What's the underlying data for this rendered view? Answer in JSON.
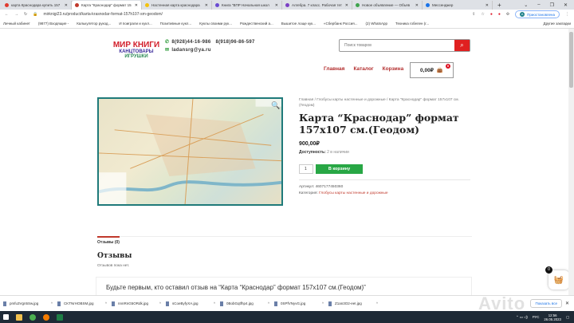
{
  "browser": {
    "tabs": [
      {
        "label": "карта Краснодара купить 157",
        "color": "#e03b2f",
        "active": false
      },
      {
        "label": "Карта \"Краснодар\" формат 15",
        "color": "#c0392b",
        "active": true
      },
      {
        "label": "Настенная карта краснодара",
        "color": "#f4c20d",
        "active": false
      },
      {
        "label": "Книга \"ВПР Начальная школ",
        "color": "#6a4bd1",
        "active": false
      },
      {
        "label": "Алгебра. 7 класс. Рабочая тет",
        "color": "#7b3fc4",
        "active": false
      },
      {
        "label": "Новое объявление — Объяв",
        "color": "#3fa34d",
        "active": false
      },
      {
        "label": "Мессенджер",
        "color": "#1a73e8",
        "active": false
      }
    ],
    "url": "mirknigi23.ru/product/karta-krasnodar-format-157h107-sm-geodom/",
    "profile": "Приостановлена",
    "profile_initial": "А",
    "bookmarks": [
      "Личный кабинет",
      "(9877) Входящие -",
      "Калькулятор рукод...",
      "И поиграли и кукл...",
      "Позитивные кукл...",
      "Куклы своими рук...",
      "Рождественский а...",
      "Вышитое лоще кук...",
      "«Сбербанк Россия...",
      "(2) WhatsApp",
      "Техника гобелен (г..."
    ],
    "other_bookmarks": "Другие закладки"
  },
  "header": {
    "logo": {
      "line1": "МИР КНИГИ",
      "line2": "КАНЦТОВАРЫ",
      "line3": "ИГРУШКИ"
    },
    "phone1": "8(928)44-16-986",
    "phone2": "8(918)96-86-597",
    "email": "ladansrg@ya.ru",
    "search_placeholder": "Поиск товаров",
    "nav": [
      "Главная",
      "Каталог",
      "Корзина"
    ],
    "cart_total": "0,00₽",
    "cart_count": "0"
  },
  "product": {
    "breadcrumb": "Главная / Глобусы карты настенные и дорожные / Карта \"Краснодар\" формат 157х107 см.(Геодом)",
    "title": "Карта “Краснодар” формат 157х107 см.(Геодом)",
    "price": "900,00₽",
    "availability_label": "Доступность:",
    "availability_value": "2 в наличии",
    "qty": "1",
    "add_to_cart": "В корзину",
    "sku_label": "Артикул:",
    "sku": "4607177450360",
    "category_label": "Категория:",
    "category": "Глобусы карты настенные и дорожные"
  },
  "reviews": {
    "tab": "Отзывы (0)",
    "heading": "Отзывы",
    "none": "Отзывов пока нет.",
    "prompt": "Будьте первым, кто оставил отзыв на “Карта “Краснодар” формат 157х107 см.(Геодом)”"
  },
  "floating_cart_count": "0",
  "downloads": {
    "files": [
      "pmfu3Vgn5Sw.jpg",
      "CKTNrHOBSM.jpg",
      "nnnRnG5ORdk.jpg",
      "sCoeByfyXA.jpg",
      "0BobGqtfhp4.jpg",
      "0SPfVNyvG.jpg",
      "Z1an3O2-eeI.jpg"
    ],
    "show_all": "Показать все"
  },
  "taskbar": {
    "lang": "РУС",
    "time": "12:56",
    "date": "26.05.2023"
  },
  "watermark": "Avito"
}
